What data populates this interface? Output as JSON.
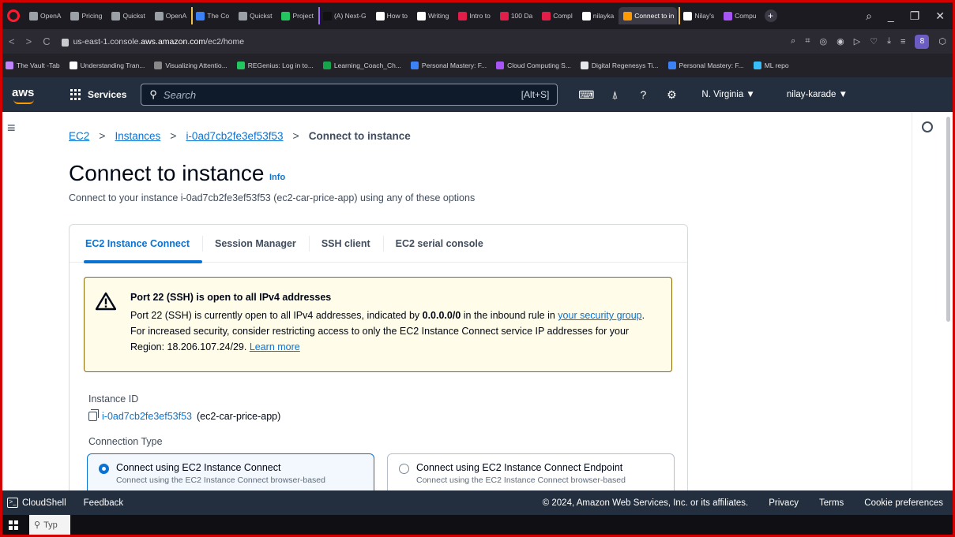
{
  "browser": {
    "tabs": [
      {
        "label": "OpenA",
        "color": "#9aa0a6",
        "group": ""
      },
      {
        "label": "Pricing",
        "color": "#9aa0a6",
        "group": ""
      },
      {
        "label": "Quickst",
        "color": "#9aa0a6",
        "group": ""
      },
      {
        "label": "OpenA",
        "color": "#9aa0a6",
        "group": ""
      },
      {
        "label": "The Co",
        "color": "#3b82f6",
        "group": "group-yellow"
      },
      {
        "label": "Quickst",
        "color": "#9aa0a6",
        "group": ""
      },
      {
        "label": "Project",
        "color": "#22c55e",
        "group": ""
      },
      {
        "label": "(A) Next-G",
        "color": "#111111",
        "group": "group-purple"
      },
      {
        "label": "How to",
        "color": "#ffffff",
        "group": ""
      },
      {
        "label": "Writing",
        "color": "#ffffff",
        "group": ""
      },
      {
        "label": "Intro to",
        "color": "#e11d48",
        "group": ""
      },
      {
        "label": "100 Da",
        "color": "#e11d48",
        "group": ""
      },
      {
        "label": "Compl",
        "color": "#e11d48",
        "group": ""
      },
      {
        "label": "nilayka",
        "color": "#ffffff",
        "group": ""
      },
      {
        "label": "Connect to in",
        "color": "#ff9900",
        "group": "",
        "active": true
      },
      {
        "label": "Nilay's",
        "color": "#ffffff",
        "group": "group-yellow"
      },
      {
        "label": "Compu",
        "color": "#a855f7",
        "group": ""
      }
    ],
    "url_prefix": "us-east-1.console.",
    "url_domain": "aws.amazon.com",
    "url_path": "/ec2/home",
    "bookmarks": [
      {
        "label": "The Vault -Tab",
        "color": "#c084fc"
      },
      {
        "label": "Understanding Tran...",
        "color": "#ffffff"
      },
      {
        "label": "Visualizing Attentio...",
        "color": "#888888"
      },
      {
        "label": "REGenius: Log in to...",
        "color": "#22c55e"
      },
      {
        "label": "Learning_Coach_Ch...",
        "color": "#16a34a"
      },
      {
        "label": "Personal Mastery: F...",
        "color": "#3b82f6"
      },
      {
        "label": "Cloud Computing S...",
        "color": "#a855f7"
      },
      {
        "label": "Digital Regenesys Ti...",
        "color": "#e5e7eb"
      },
      {
        "label": "Personal Mastery: F...",
        "color": "#3b82f6"
      },
      {
        "label": "ML repo",
        "color": "#38bdf8"
      }
    ]
  },
  "aws_nav": {
    "logo": "aws",
    "services_label": "Services",
    "search_placeholder": "Search",
    "search_shortcut": "[Alt+S]",
    "region": "N. Virginia ▼",
    "user": "nilay-karade ▼"
  },
  "breadcrumb": {
    "items": [
      "EC2",
      "Instances",
      "i-0ad7cb2fe3ef53f53"
    ],
    "current": "Connect to instance"
  },
  "page": {
    "title": "Connect to instance",
    "info": "Info",
    "subtitle": "Connect to your instance i-0ad7cb2fe3ef53f53 (ec2-car-price-app) using any of these options"
  },
  "tabs": [
    "EC2 Instance Connect",
    "Session Manager",
    "SSH client",
    "EC2 serial console"
  ],
  "alert": {
    "title": "Port 22 (SSH) is open to all IPv4 addresses",
    "body_1": "Port 22 (SSH) is currently open to all IPv4 addresses, indicated by ",
    "body_bold": "0.0.0.0/0",
    "body_2": " in the inbound rule in ",
    "link_1": "your security group",
    "body_3": ". For increased security, consider restricting access to only the EC2 Instance Connect service IP addresses for your Region: 18.206.107.24/29. ",
    "link_2": "Learn more"
  },
  "instance": {
    "label": "Instance ID",
    "id": "i-0ad7cb2fe3ef53f53",
    "name": "(ec2-car-price-app)"
  },
  "connection_type": {
    "label": "Connection Type",
    "options": [
      {
        "title": "Connect using EC2 Instance Connect",
        "desc": "Connect using the EC2 Instance Connect browser-based"
      },
      {
        "title": "Connect using EC2 Instance Connect Endpoint",
        "desc": "Connect using the EC2 Instance Connect browser-based"
      }
    ]
  },
  "footer": {
    "cloudshell": "CloudShell",
    "feedback": "Feedback",
    "copyright": "© 2024, Amazon Web Services, Inc. or its affiliates.",
    "privacy": "Privacy",
    "terms": "Terms",
    "cookies": "Cookie preferences"
  },
  "taskbar": {
    "search": "Typ"
  },
  "colors": {
    "accent": "#0972d3",
    "aws_nav": "#232f3e",
    "warning_bg": "#fffce9",
    "warning_border": "#8d6605"
  }
}
